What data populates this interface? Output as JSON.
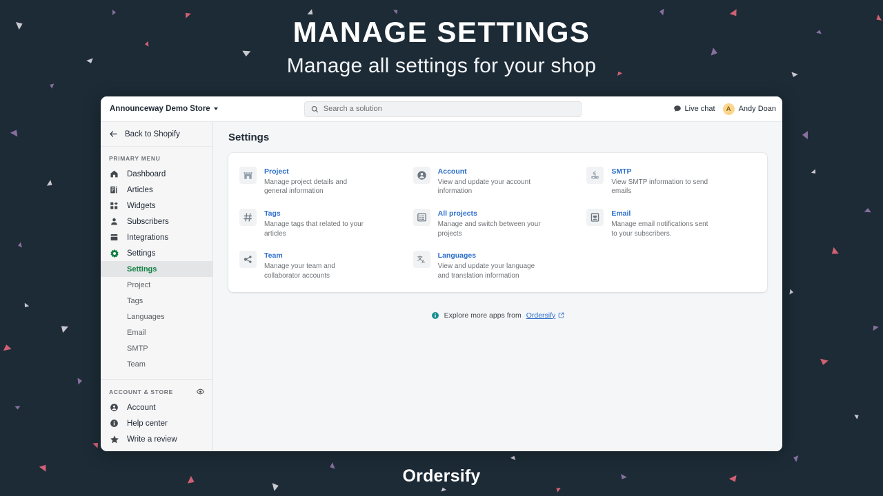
{
  "hero": {
    "title": "MANAGE SETTINGS",
    "subtitle": "Manage all settings for your shop"
  },
  "brand": {
    "name": "Ordersify"
  },
  "colors": {
    "background": "#1c2b36",
    "accent_green": "#108043",
    "link_blue": "#2c6ecb",
    "avatar_bg": "#fcd68c",
    "confetti_purple": "#9b7bb0",
    "confetti_pink": "#f06a7e",
    "confetti_white": "#e8e4ea"
  },
  "topbar": {
    "store_name": "Announceway Demo Store",
    "store_caret_icon": "chevron-down-icon",
    "search": {
      "icon": "search-icon",
      "placeholder": "Search a solution",
      "value": ""
    },
    "live_chat": {
      "icon": "chat-bubble-icon",
      "label": "Live chat"
    },
    "user": {
      "avatar_initial": "A",
      "name": "Andy Doan"
    }
  },
  "sidebar": {
    "back": {
      "icon": "arrow-left-icon",
      "label": "Back to Shopify"
    },
    "primary_label": "PRIMARY MENU",
    "primary_items": [
      {
        "icon": "home-icon",
        "label": "Dashboard"
      },
      {
        "icon": "article-icon",
        "label": "Articles"
      },
      {
        "icon": "widgets-icon",
        "label": "Widgets"
      },
      {
        "icon": "person-icon",
        "label": "Subscribers"
      },
      {
        "icon": "integrations-icon",
        "label": "Integrations"
      },
      {
        "icon": "gear-icon",
        "label": "Settings"
      }
    ],
    "sub_items": [
      {
        "label": "Settings",
        "active": true
      },
      {
        "label": "Project",
        "active": false
      },
      {
        "label": "Tags",
        "active": false
      },
      {
        "label": "Languages",
        "active": false
      },
      {
        "label": "Email",
        "active": false
      },
      {
        "label": "SMTP",
        "active": false
      },
      {
        "label": "Team",
        "active": false
      }
    ],
    "account_label": "ACCOUNT & STORE",
    "account_eye_icon": "eye-icon",
    "account_items": [
      {
        "icon": "account-circle-icon",
        "label": "Account"
      },
      {
        "icon": "info-circle-icon",
        "label": "Help center"
      },
      {
        "icon": "star-icon",
        "label": "Write a review"
      }
    ]
  },
  "main": {
    "page_title": "Settings",
    "cards": [
      {
        "icon": "storefront-icon",
        "title": "Project",
        "desc": "Manage project details and general information"
      },
      {
        "icon": "account-circle-icon",
        "title": "Account",
        "desc": "View and update your account information"
      },
      {
        "icon": "router-icon",
        "title": "SMTP",
        "desc": "View SMTP information to send emails"
      },
      {
        "icon": "hash-icon",
        "title": "Tags",
        "desc": "Manage tags that related to your articles"
      },
      {
        "icon": "list-icon",
        "title": "All projects",
        "desc": "Manage and switch between your projects"
      },
      {
        "icon": "envelope-icon",
        "title": "Email",
        "desc": "Manage email notifications sent to your subscribers."
      },
      {
        "icon": "network-icon",
        "title": "Team",
        "desc": "Manage your team and collaborator accounts"
      },
      {
        "icon": "translate-icon",
        "title": "Languages",
        "desc": "View and update your language and translation information"
      }
    ],
    "footer": {
      "icon": "info-circle-icon",
      "text": "Explore more apps from",
      "link_label": "Ordersify",
      "external_icon": "external-link-icon"
    }
  }
}
